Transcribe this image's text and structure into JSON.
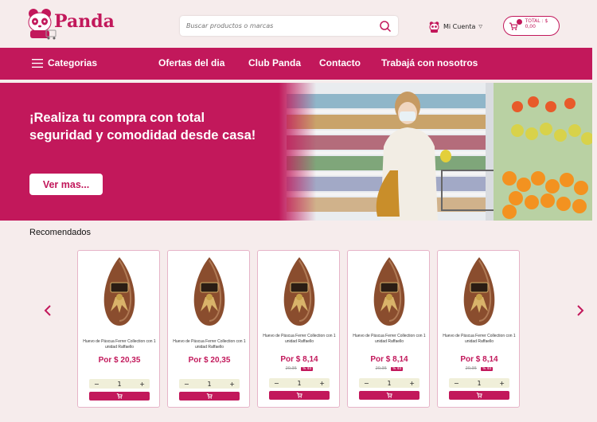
{
  "brand": {
    "name": "Panda"
  },
  "search": {
    "placeholder": "Buscar productos o marcas"
  },
  "account": {
    "label": "Mi Cuenta"
  },
  "cart": {
    "total": "TOTAL : $ 0,00"
  },
  "nav": {
    "categories": "Categorias",
    "links": [
      "Ofertas del dia",
      "Club Panda",
      "Contacto",
      "Trabajá con nosotros"
    ]
  },
  "hero": {
    "title": "¡Realiza tu compra con total seguridad y comodidad desde casa!",
    "button": "Ver mas..."
  },
  "recommended": {
    "title": "Recomendados",
    "products": [
      {
        "name": "Huevo de Páscua Ferrer Collection con 1 unidad Raffaello",
        "price": "Por $ 20,35",
        "old_price": "",
        "discount": "",
        "qty": "1"
      },
      {
        "name": "Huevo de Páscua Ferrer Collection con 1 unidad Raffaello",
        "price": "Por $ 20,35",
        "old_price": "",
        "discount": "",
        "qty": "1"
      },
      {
        "name": "Huevo de Páscua Ferrer Collection con 1 unidad Raffaello",
        "price": "Por $ 8,14",
        "old_price": "20,35",
        "discount": "% 40",
        "qty": "1"
      },
      {
        "name": "Huevo de Páscua Ferrer Collection con 1 unidad Raffaello",
        "price": "Por $ 8,14",
        "old_price": "20,35",
        "discount": "% 40",
        "qty": "1"
      },
      {
        "name": "Huevo de Páscua Ferrer Collection con 1 unidad Raffaello",
        "price": "Por $ 8,14",
        "old_price": "20,35",
        "discount": "% 40",
        "qty": "1"
      }
    ],
    "minus": "−",
    "plus": "+"
  },
  "colors": {
    "brand": "#c2185b",
    "background": "#f6ecec"
  }
}
